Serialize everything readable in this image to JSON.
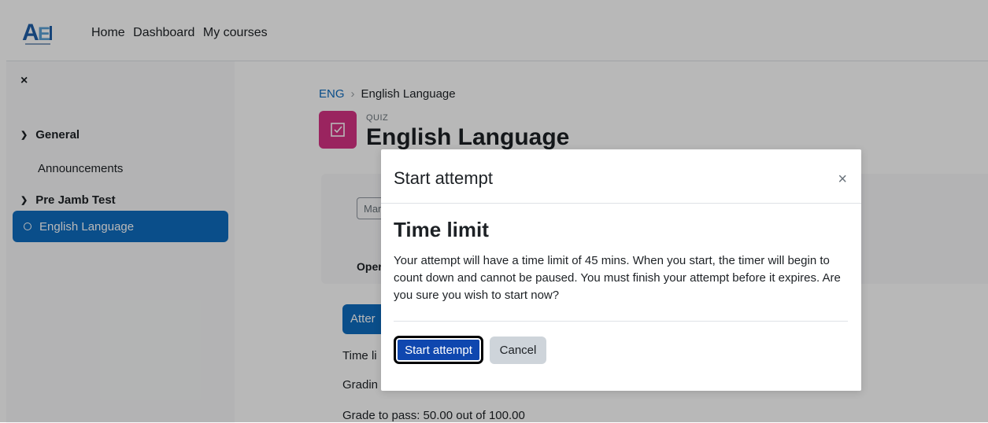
{
  "navbar": {
    "logo_text": "AEi",
    "links": [
      "Home",
      "Dashboard",
      "My courses"
    ]
  },
  "sidebar": {
    "close_glyph": "×",
    "sections": [
      {
        "label": "General",
        "items": [
          "Announcements"
        ]
      },
      {
        "label": "Pre Jamb Test",
        "items": [
          "English Language"
        ]
      }
    ],
    "active_item": "English Language"
  },
  "main": {
    "breadcrumb": [
      "ENG",
      "English Language"
    ],
    "quiz_label": "QUIZ",
    "title": "English Language",
    "mark_box_text": "Mar",
    "opened_text": "Oper",
    "attempt_button": "Atter",
    "meta": [
      "Time li",
      "Gradin",
      "Grade to pass: 50.00 out of 100.00"
    ]
  },
  "modal": {
    "title": "Start attempt",
    "close_glyph": "×",
    "heading": "Time limit",
    "body": "Your attempt will have a time limit of 45 mins. When you start, the timer will begin to count down and cannot be paused. You must finish your attempt before it expires. Are you sure you wish to start now?",
    "start_button": "Start attempt",
    "cancel_button": "Cancel"
  },
  "colors": {
    "accent": "#0f6cbf",
    "quiz_icon_bg": "#d63384",
    "start_button_bg": "#0f47af"
  }
}
